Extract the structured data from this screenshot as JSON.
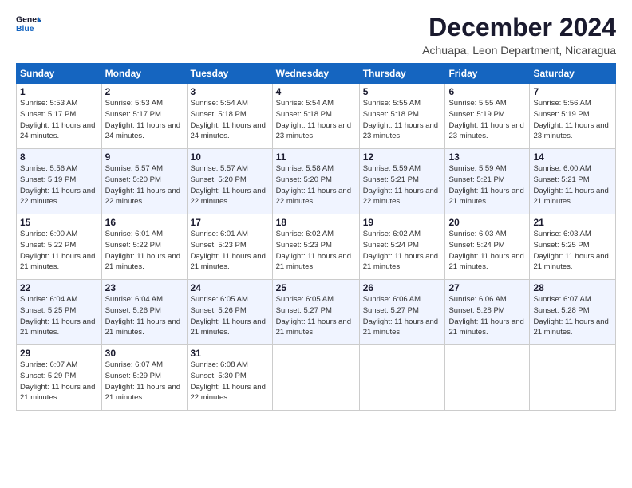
{
  "logo": {
    "text_general": "General",
    "text_blue": "Blue"
  },
  "header": {
    "title": "December 2024",
    "subtitle": "Achuapa, Leon Department, Nicaragua"
  },
  "days_of_week": [
    "Sunday",
    "Monday",
    "Tuesday",
    "Wednesday",
    "Thursday",
    "Friday",
    "Saturday"
  ],
  "weeks": [
    [
      {
        "day": "1",
        "sunrise": "Sunrise: 5:53 AM",
        "sunset": "Sunset: 5:17 PM",
        "daylight": "Daylight: 11 hours and 24 minutes."
      },
      {
        "day": "2",
        "sunrise": "Sunrise: 5:53 AM",
        "sunset": "Sunset: 5:17 PM",
        "daylight": "Daylight: 11 hours and 24 minutes."
      },
      {
        "day": "3",
        "sunrise": "Sunrise: 5:54 AM",
        "sunset": "Sunset: 5:18 PM",
        "daylight": "Daylight: 11 hours and 24 minutes."
      },
      {
        "day": "4",
        "sunrise": "Sunrise: 5:54 AM",
        "sunset": "Sunset: 5:18 PM",
        "daylight": "Daylight: 11 hours and 23 minutes."
      },
      {
        "day": "5",
        "sunrise": "Sunrise: 5:55 AM",
        "sunset": "Sunset: 5:18 PM",
        "daylight": "Daylight: 11 hours and 23 minutes."
      },
      {
        "day": "6",
        "sunrise": "Sunrise: 5:55 AM",
        "sunset": "Sunset: 5:19 PM",
        "daylight": "Daylight: 11 hours and 23 minutes."
      },
      {
        "day": "7",
        "sunrise": "Sunrise: 5:56 AM",
        "sunset": "Sunset: 5:19 PM",
        "daylight": "Daylight: 11 hours and 23 minutes."
      }
    ],
    [
      {
        "day": "8",
        "sunrise": "Sunrise: 5:56 AM",
        "sunset": "Sunset: 5:19 PM",
        "daylight": "Daylight: 11 hours and 22 minutes."
      },
      {
        "day": "9",
        "sunrise": "Sunrise: 5:57 AM",
        "sunset": "Sunset: 5:20 PM",
        "daylight": "Daylight: 11 hours and 22 minutes."
      },
      {
        "day": "10",
        "sunrise": "Sunrise: 5:57 AM",
        "sunset": "Sunset: 5:20 PM",
        "daylight": "Daylight: 11 hours and 22 minutes."
      },
      {
        "day": "11",
        "sunrise": "Sunrise: 5:58 AM",
        "sunset": "Sunset: 5:20 PM",
        "daylight": "Daylight: 11 hours and 22 minutes."
      },
      {
        "day": "12",
        "sunrise": "Sunrise: 5:59 AM",
        "sunset": "Sunset: 5:21 PM",
        "daylight": "Daylight: 11 hours and 22 minutes."
      },
      {
        "day": "13",
        "sunrise": "Sunrise: 5:59 AM",
        "sunset": "Sunset: 5:21 PM",
        "daylight": "Daylight: 11 hours and 21 minutes."
      },
      {
        "day": "14",
        "sunrise": "Sunrise: 6:00 AM",
        "sunset": "Sunset: 5:21 PM",
        "daylight": "Daylight: 11 hours and 21 minutes."
      }
    ],
    [
      {
        "day": "15",
        "sunrise": "Sunrise: 6:00 AM",
        "sunset": "Sunset: 5:22 PM",
        "daylight": "Daylight: 11 hours and 21 minutes."
      },
      {
        "day": "16",
        "sunrise": "Sunrise: 6:01 AM",
        "sunset": "Sunset: 5:22 PM",
        "daylight": "Daylight: 11 hours and 21 minutes."
      },
      {
        "day": "17",
        "sunrise": "Sunrise: 6:01 AM",
        "sunset": "Sunset: 5:23 PM",
        "daylight": "Daylight: 11 hours and 21 minutes."
      },
      {
        "day": "18",
        "sunrise": "Sunrise: 6:02 AM",
        "sunset": "Sunset: 5:23 PM",
        "daylight": "Daylight: 11 hours and 21 minutes."
      },
      {
        "day": "19",
        "sunrise": "Sunrise: 6:02 AM",
        "sunset": "Sunset: 5:24 PM",
        "daylight": "Daylight: 11 hours and 21 minutes."
      },
      {
        "day": "20",
        "sunrise": "Sunrise: 6:03 AM",
        "sunset": "Sunset: 5:24 PM",
        "daylight": "Daylight: 11 hours and 21 minutes."
      },
      {
        "day": "21",
        "sunrise": "Sunrise: 6:03 AM",
        "sunset": "Sunset: 5:25 PM",
        "daylight": "Daylight: 11 hours and 21 minutes."
      }
    ],
    [
      {
        "day": "22",
        "sunrise": "Sunrise: 6:04 AM",
        "sunset": "Sunset: 5:25 PM",
        "daylight": "Daylight: 11 hours and 21 minutes."
      },
      {
        "day": "23",
        "sunrise": "Sunrise: 6:04 AM",
        "sunset": "Sunset: 5:26 PM",
        "daylight": "Daylight: 11 hours and 21 minutes."
      },
      {
        "day": "24",
        "sunrise": "Sunrise: 6:05 AM",
        "sunset": "Sunset: 5:26 PM",
        "daylight": "Daylight: 11 hours and 21 minutes."
      },
      {
        "day": "25",
        "sunrise": "Sunrise: 6:05 AM",
        "sunset": "Sunset: 5:27 PM",
        "daylight": "Daylight: 11 hours and 21 minutes."
      },
      {
        "day": "26",
        "sunrise": "Sunrise: 6:06 AM",
        "sunset": "Sunset: 5:27 PM",
        "daylight": "Daylight: 11 hours and 21 minutes."
      },
      {
        "day": "27",
        "sunrise": "Sunrise: 6:06 AM",
        "sunset": "Sunset: 5:28 PM",
        "daylight": "Daylight: 11 hours and 21 minutes."
      },
      {
        "day": "28",
        "sunrise": "Sunrise: 6:07 AM",
        "sunset": "Sunset: 5:28 PM",
        "daylight": "Daylight: 11 hours and 21 minutes."
      }
    ],
    [
      {
        "day": "29",
        "sunrise": "Sunrise: 6:07 AM",
        "sunset": "Sunset: 5:29 PM",
        "daylight": "Daylight: 11 hours and 21 minutes."
      },
      {
        "day": "30",
        "sunrise": "Sunrise: 6:07 AM",
        "sunset": "Sunset: 5:29 PM",
        "daylight": "Daylight: 11 hours and 21 minutes."
      },
      {
        "day": "31",
        "sunrise": "Sunrise: 6:08 AM",
        "sunset": "Sunset: 5:30 PM",
        "daylight": "Daylight: 11 hours and 22 minutes."
      },
      {
        "day": "",
        "sunrise": "",
        "sunset": "",
        "daylight": ""
      },
      {
        "day": "",
        "sunrise": "",
        "sunset": "",
        "daylight": ""
      },
      {
        "day": "",
        "sunrise": "",
        "sunset": "",
        "daylight": ""
      },
      {
        "day": "",
        "sunrise": "",
        "sunset": "",
        "daylight": ""
      }
    ]
  ]
}
